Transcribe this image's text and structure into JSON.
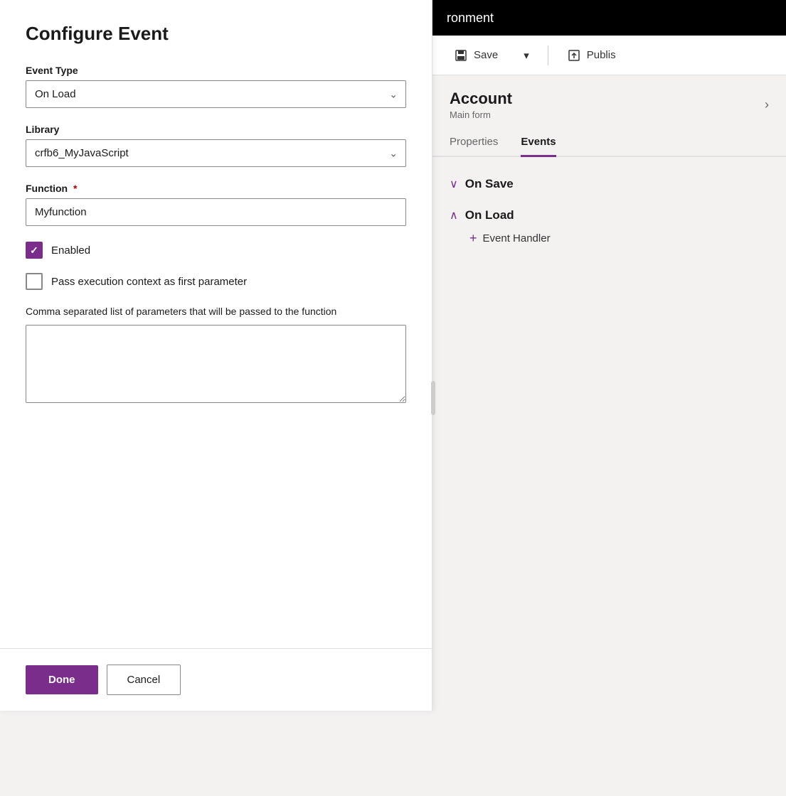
{
  "modal": {
    "title": "Configure Event",
    "event_type_label": "Event Type",
    "event_type_value": "On Load",
    "library_label": "Library",
    "library_value": "crfb6_MyJavaScript",
    "function_label": "Function",
    "function_required": "*",
    "function_value": "Myfunction",
    "enabled_label": "Enabled",
    "enabled_checked": true,
    "pass_context_label": "Pass execution context as first parameter",
    "pass_context_checked": false,
    "params_label": "Comma separated list of parameters that will be passed to the function",
    "params_value": "",
    "done_label": "Done",
    "cancel_label": "Cancel"
  },
  "right_panel": {
    "header_text": "ronment",
    "save_label": "Save",
    "publish_label": "Publis",
    "account_title": "Account",
    "account_subtitle": "Main form",
    "tab_properties": "Properties",
    "tab_events": "Events",
    "on_save_label": "On Save",
    "on_load_label": "On Load",
    "add_handler_label": "Event Handler"
  },
  "icons": {
    "save": "💾",
    "publish": "📤",
    "chevron_down": "⌄",
    "chevron_right": "›",
    "plus": "+",
    "collapse": "∧",
    "expand": "∨"
  }
}
